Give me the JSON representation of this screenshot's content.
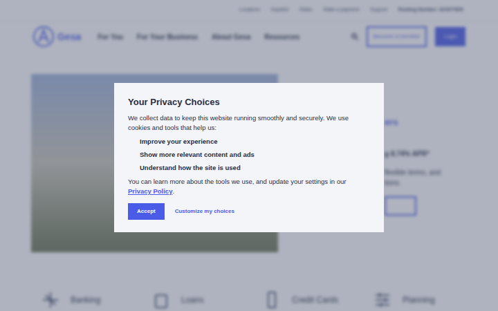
{
  "utility_bar": [
    "Locations",
    "Español",
    "Rates",
    "Make a payment",
    "Support",
    "Routing Number: 324377820"
  ],
  "logo": {
    "text": "Gesa"
  },
  "nav": {
    "items": [
      "For You",
      "For Your Business",
      "About Gesa",
      "Resources"
    ],
    "secondary_button": "Become a member",
    "primary_button": "Login"
  },
  "hero": {
    "heading": "ers",
    "rate": "g 8.74% APR*",
    "body": [
      "flexible terms, and",
      "tions."
    ]
  },
  "categories": [
    "Banking",
    "Loans",
    "Credit Cards",
    "Planning"
  ],
  "dialog": {
    "title": "Your Privacy Choices",
    "intro": "We collect data to keep this website running smoothly and securely. We use cookies and tools that help us:",
    "items": [
      "Improve your experience",
      "Show more relevant content and ads",
      "Understand how the site is used"
    ],
    "outro_before": "You can learn more about the tools we use, and update your settings in our",
    "link": "Privacy Policy",
    "outro_after": ".",
    "accept": "Accept",
    "customize": "Customize my choices"
  }
}
